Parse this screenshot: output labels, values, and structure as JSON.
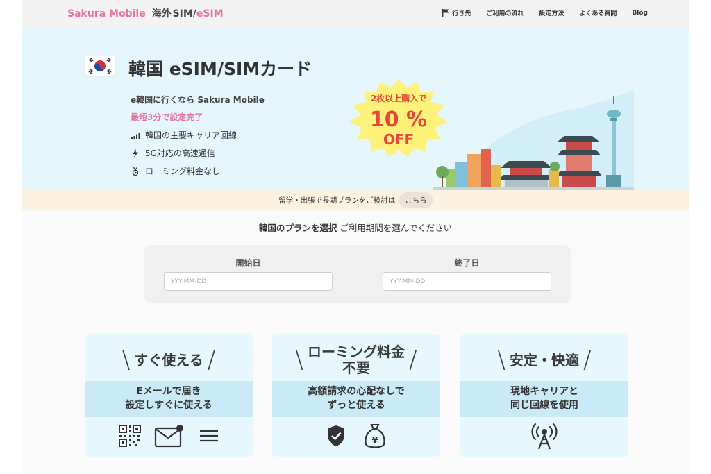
{
  "header": {
    "logo": "Sakura Mobile",
    "logo_suffix_jp": "海外",
    "logo_suffix_sim": "SIM/",
    "logo_suffix_esim": "eSIM",
    "nav": [
      {
        "label": "行き先",
        "icon": "flag-icon"
      },
      {
        "label": "ご利用の流れ"
      },
      {
        "label": "設定方法"
      },
      {
        "label": "よくある質問"
      },
      {
        "label": "Blog"
      }
    ]
  },
  "hero": {
    "title": "韓国 eSIM/SIMカード",
    "tagline": "e韓国に行くなら Sakura Mobile",
    "subtitle": "最短3分で設定完了",
    "features": [
      {
        "icon": "signal-bars-icon",
        "text": "韓国の主要キャリア回線"
      },
      {
        "icon": "lightning-icon",
        "text": "5G対応の高速通信"
      },
      {
        "icon": "medal-icon",
        "text": "ローミング料金なし"
      }
    ],
    "badge": {
      "line1": "2枚以上購入で",
      "line2": "10 %",
      "line3": "OFF"
    },
    "colors": {
      "bg": "#e5f7fc",
      "pink": "#e9739f",
      "badge_yellow": "#fff27a",
      "badge_red": "#e8473c"
    }
  },
  "long_plan": {
    "text": "留学・出張で長期プランをご検討は",
    "link": "こちら"
  },
  "plan_select": {
    "heading_bold": "韓国のプランを選択",
    "heading_rest": " ご利用期間を選んでください",
    "start_label": "開始日",
    "end_label": "終了日",
    "start_placeholder": "YYY-MM-DD",
    "end_placeholder": "YYY-MM-DD"
  },
  "cards": [
    {
      "title": "すぐ使える",
      "band": "Eメールで届き\n設定しすぐに使える",
      "icons": [
        "qr-code-icon",
        "email-icon",
        "list-lines-icon"
      ]
    },
    {
      "title": "ローミング料金\n不要",
      "band": "高額請求の心配なしで\nずっと使える",
      "icons": [
        "shield-check-icon",
        "money-bag-icon"
      ]
    },
    {
      "title": "安定・快適",
      "band": "現地キャリアと\n同じ回線を使用",
      "icons": [
        "antenna-tower-icon"
      ]
    }
  ]
}
